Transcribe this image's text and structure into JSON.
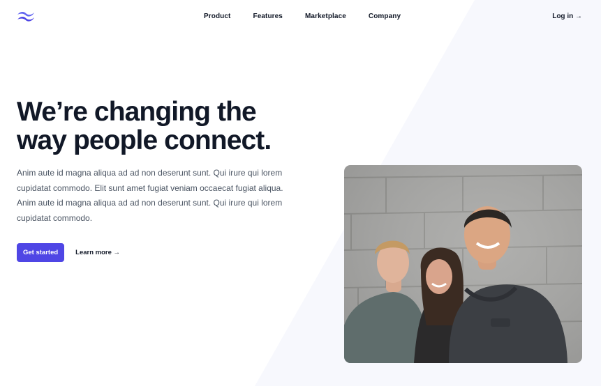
{
  "brand": {
    "logo_icon": "wave-logo-icon",
    "accent_color": "#4f46e5"
  },
  "nav": {
    "items": [
      {
        "label": "Product"
      },
      {
        "label": "Features"
      },
      {
        "label": "Marketplace"
      },
      {
        "label": "Company"
      }
    ],
    "login_label": "Log in →"
  },
  "hero": {
    "title_line1": "We’re changing the",
    "title_line2": "way people connect.",
    "lead": "Anim aute id magna aliqua ad ad non deserunt sunt. Qui irure qui lorem cupidatat commodo. Elit sunt amet fugiat veniam occaecat fugiat aliqua. Anim aute id magna aliqua ad ad non deserunt sunt. Qui irure qui lorem cupidatat commodo.",
    "primary_cta": "Get started",
    "secondary_cta": "Learn more →"
  },
  "photo": {
    "icon": "team-photo"
  }
}
